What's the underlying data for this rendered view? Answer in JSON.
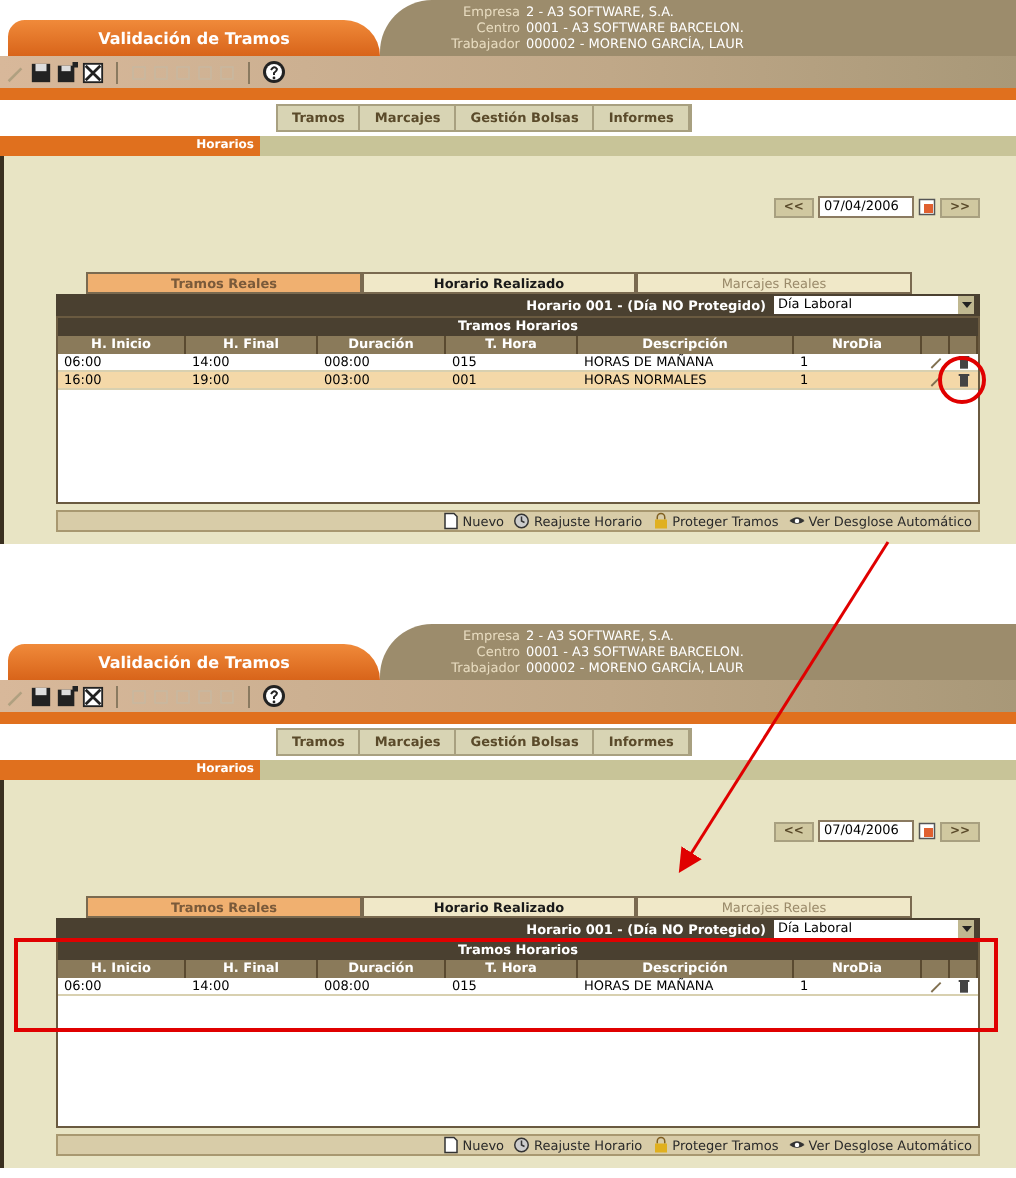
{
  "panels": [
    {
      "title": "Validación de Tramos",
      "info": [
        {
          "label": "Empresa",
          "value": "2 - A3 SOFTWARE, S.A."
        },
        {
          "label": "Centro",
          "value": "0001 - A3 SOFTWARE BARCELON."
        },
        {
          "label": "Trabajador",
          "value": "000002 - MORENO GARCÍA, LAUR"
        }
      ],
      "menu": [
        "Tramos",
        "Marcajes",
        "Gestión Bolsas",
        "Informes"
      ],
      "section": "Horarios",
      "date": {
        "prev": "<<",
        "value": "07/04/2006",
        "next": ">>"
      },
      "views": [
        {
          "label": "Tramos Reales",
          "selected": true,
          "disabled": false
        },
        {
          "label": "Horario Realizado",
          "selected": false,
          "disabled": false
        },
        {
          "label": "Marcajes Reales",
          "selected": false,
          "disabled": true
        }
      ],
      "horario": {
        "label": "Horario 001 - (Día NO Protegido)",
        "select": "Día Laboral"
      },
      "table": {
        "title": "Tramos Horarios",
        "framed": false,
        "columns": [
          "H. Inicio",
          "H. Final",
          "Duración",
          "T. Hora",
          "Descripción",
          "NroDia"
        ],
        "rows": [
          {
            "cells": [
              "06:00",
              "14:00",
              "008:00",
              "015",
              "HORAS DE MAÑANA",
              "1"
            ],
            "selected": false,
            "circled": false
          },
          {
            "cells": [
              "16:00",
              "19:00",
              "003:00",
              "001",
              "HORAS NORMALES",
              "1"
            ],
            "selected": true,
            "circled": true
          }
        ]
      },
      "actions": [
        "Nuevo",
        "Reajuste Horario",
        "Proteger Tramos",
        "Ver Desglose Automático"
      ]
    },
    {
      "title": "Validación de Tramos",
      "info": [
        {
          "label": "Empresa",
          "value": "2 - A3 SOFTWARE, S.A."
        },
        {
          "label": "Centro",
          "value": "0001 - A3 SOFTWARE BARCELON."
        },
        {
          "label": "Trabajador",
          "value": "000002 - MORENO GARCÍA, LAUR"
        }
      ],
      "menu": [
        "Tramos",
        "Marcajes",
        "Gestión Bolsas",
        "Informes"
      ],
      "section": "Horarios",
      "date": {
        "prev": "<<",
        "value": "07/04/2006",
        "next": ">>"
      },
      "views": [
        {
          "label": "Tramos Reales",
          "selected": true,
          "disabled": false
        },
        {
          "label": "Horario Realizado",
          "selected": false,
          "disabled": false
        },
        {
          "label": "Marcajes Reales",
          "selected": false,
          "disabled": true
        }
      ],
      "horario": {
        "label": "Horario 001 - (Día NO Protegido)",
        "select": "Día Laboral"
      },
      "table": {
        "title": "Tramos Horarios",
        "framed": true,
        "columns": [
          "H. Inicio",
          "H. Final",
          "Duración",
          "T. Hora",
          "Descripción",
          "NroDia"
        ],
        "rows": [
          {
            "cells": [
              "06:00",
              "14:00",
              "008:00",
              "015",
              "HORAS DE MAÑANA",
              "1"
            ],
            "selected": false,
            "circled": false
          }
        ]
      },
      "actions": [
        "Nuevo",
        "Reajuste Horario",
        "Proteger Tramos",
        "Ver Desglose Automático"
      ]
    }
  ]
}
